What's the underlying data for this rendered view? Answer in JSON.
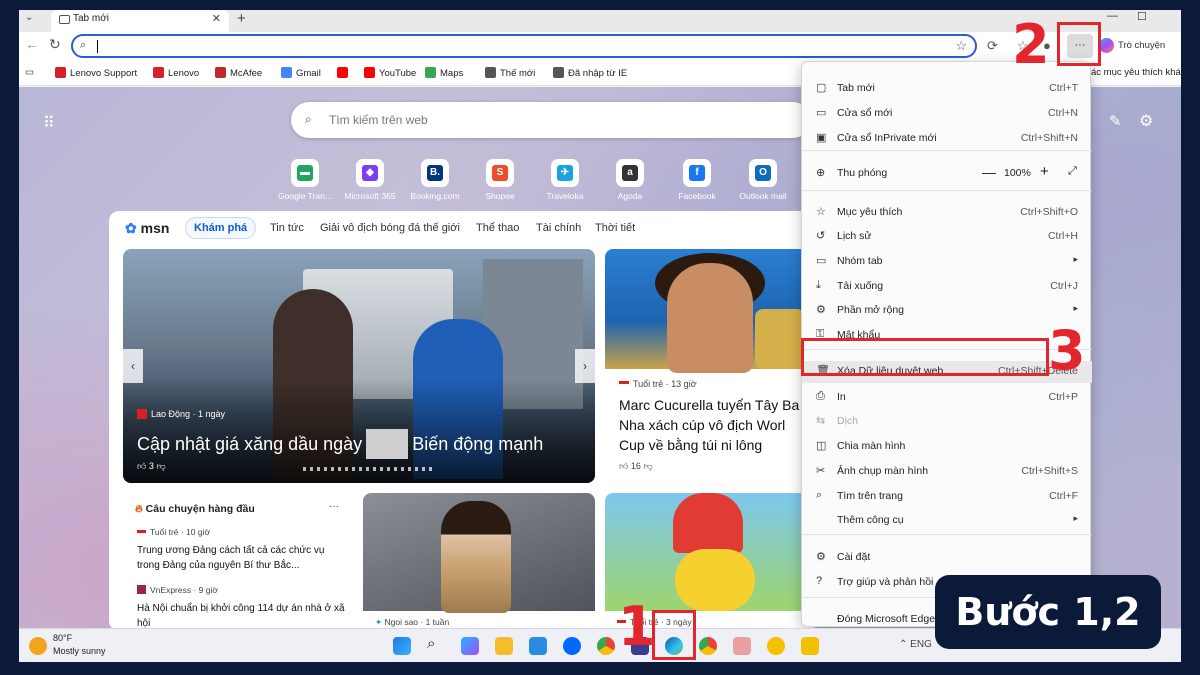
{
  "browser": {
    "tab_title": "Tab mới",
    "address_value": "",
    "copilot_label": "Trò chuyện",
    "more_label": "···"
  },
  "bookmarks": [
    {
      "label": "Lenovo Support",
      "color": "#d81f26"
    },
    {
      "label": "Lenovo",
      "color": "#d81f26"
    },
    {
      "label": "McAfee",
      "color": "#c1272d"
    },
    {
      "label": "Gmail",
      "color": "#4285f4"
    },
    {
      "label": "",
      "color": "#ff0000"
    },
    {
      "label": "YouTube",
      "color": "#ff0000"
    },
    {
      "label": "Maps",
      "color": "#34a853"
    },
    {
      "label": "Thế mới",
      "color": "#555555"
    },
    {
      "label": "Đã nhập từ IE",
      "color": "#555555"
    },
    {
      "label": "ác mục yêu thích khác",
      "color": "#555555"
    }
  ],
  "ntp": {
    "search_placeholder": "Tìm kiếm trên web",
    "quick_links": [
      {
        "label": "Google Tran...",
        "color": "#1fa463",
        "glyph": "▬"
      },
      {
        "label": "Microsoft 365",
        "color": "#7b3ff2",
        "glyph": "◆"
      },
      {
        "label": "Booking.com",
        "color": "#003580",
        "glyph": "B."
      },
      {
        "label": "Shopee",
        "color": "#ee4d2d",
        "glyph": "S"
      },
      {
        "label": "Traveloka",
        "color": "#1ba0e2",
        "glyph": "✈"
      },
      {
        "label": "Agoda",
        "color": "#333333",
        "glyph": "a"
      },
      {
        "label": "Facebook",
        "color": "#1877f2",
        "glyph": "f"
      },
      {
        "label": "Outlook mail",
        "color": "#0f6cbd",
        "glyph": "O"
      }
    ]
  },
  "msn": {
    "logo": "msn",
    "tabs": [
      "Khám phá",
      "Tin tức",
      "Giải vô địch bóng đá thế giới",
      "Thể thao",
      "Tài chính",
      "Thời tiết"
    ],
    "main_card": {
      "source": "Lao Động · 1 ngày",
      "headline_a": "Cập nhật giá xăng dầu ngày",
      "headline_b": "Biến động mạnh",
      "likes": "3"
    },
    "right_card": {
      "source": "Tuổi trẻ · 13 giờ",
      "line1": "Marc Cucurella tuyển Tây Ba",
      "line2": "Nha xách cúp vô địch Worl",
      "line3": "Cup về bằng túi ni lông",
      "likes": "16"
    },
    "top_stories": {
      "title": "Câu chuyện hàng đầu",
      "more": "···",
      "items": [
        {
          "source": "Tuổi trẻ · 10 giờ",
          "headline": "Trung ương Đảng cách tất cả các chức vụ trong Đảng của nguyên Bí thư Bắc...",
          "color": "#d81f26"
        },
        {
          "source": "VnExpress · 9 giờ",
          "headline": "Hà Nội chuẩn bị khởi công 114 dự án nhà ở xã hội",
          "color": "#9f224e"
        }
      ]
    },
    "mid_card": {
      "source": "Ngoi sao · 1 tuần"
    },
    "pika_card": {
      "source": "Tuổi trẻ · 3 ngày"
    }
  },
  "menu": {
    "items": [
      {
        "icon": "▢",
        "label": "Tab mới",
        "shortcut": "Ctrl+T"
      },
      {
        "icon": "▭",
        "label": "Cửa sổ mới",
        "shortcut": "Ctrl+N"
      },
      {
        "icon": "▣",
        "label": "Cửa sổ InPrivate mới",
        "shortcut": "Ctrl+Shift+N"
      },
      {
        "icon": "⊕",
        "label": "Thu phóng",
        "zoom": "100%",
        "minus": "—",
        "plus": "+",
        "full": "⤢"
      },
      {
        "icon": "☆",
        "label": "Mục yêu thích",
        "shortcut": "Ctrl+Shift+O"
      },
      {
        "icon": "↺",
        "label": "Lịch sử",
        "shortcut": "Ctrl+H"
      },
      {
        "icon": "▭",
        "label": "Nhóm tab",
        "submenu": "▸"
      },
      {
        "icon": "⤓",
        "label": "Tải xuống",
        "shortcut": "Ctrl+J"
      },
      {
        "icon": "⚙",
        "label": "Phần mở rộng",
        "submenu": "▸"
      },
      {
        "icon": "⚿",
        "label": "Mật khẩu"
      },
      {
        "icon": "🗑",
        "label": "Xóa Dữ liệu duyệt web",
        "shortcut": "Ctrl+Shift+Delete"
      },
      {
        "icon": "⎙",
        "label": "In",
        "shortcut": "Ctrl+P"
      },
      {
        "icon": "⇆",
        "label": "Dịch",
        "disabled": true
      },
      {
        "icon": "◫",
        "label": "Chia màn hình"
      },
      {
        "icon": "✂",
        "label": "Ảnh chụp màn hình",
        "shortcut": "Ctrl+Shift+S"
      },
      {
        "icon": "⌕",
        "label": "Tìm trên trang",
        "shortcut": "Ctrl+F"
      },
      {
        "icon": "",
        "label": "Thêm công cụ",
        "submenu": "▸"
      },
      {
        "icon": "⚙",
        "label": "Cài đặt"
      },
      {
        "icon": "?",
        "label": "Trợ giúp và phản hồi",
        "submenu": "▸"
      },
      {
        "icon": "",
        "label": "Đóng Microsoft Edge"
      }
    ]
  },
  "taskbar": {
    "weather_temp": "80°F",
    "weather_cond": "Mostly sunny",
    "tray_text": "ENG"
  },
  "annotations": {
    "n1": "1",
    "n2": "2",
    "n3": "3",
    "step_label": "Bước 1,2",
    "color": "#e3262d"
  }
}
